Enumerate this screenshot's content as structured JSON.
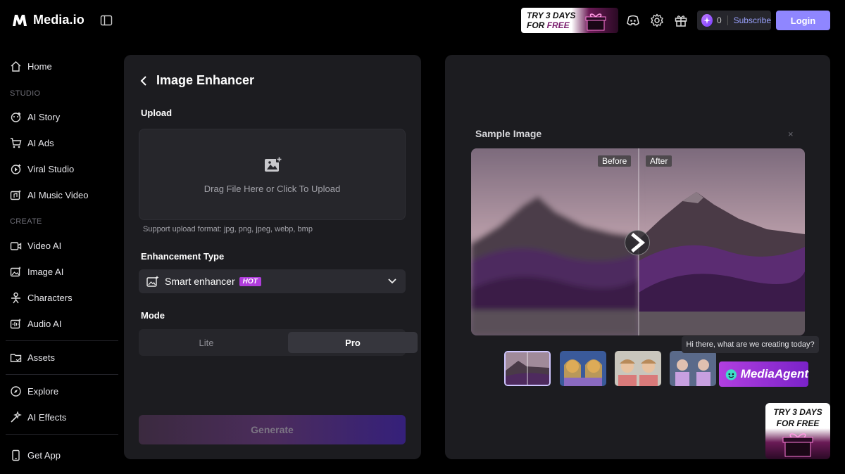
{
  "app": {
    "name": "Media.io"
  },
  "header": {
    "promo_line1": "TRY 3 DAYS",
    "promo_line2_prefix": "FOR ",
    "promo_line2_highlight": "FREE",
    "credits_count": "0",
    "subscribe_label": "Subscribe",
    "login_label": "Login"
  },
  "sidebar": {
    "home": "Home",
    "section_studio": "STUDIO",
    "ai_story": "AI Story",
    "ai_ads": "AI Ads",
    "viral_studio": "Viral Studio",
    "ai_music_video": "AI Music Video",
    "section_create": "CREATE",
    "video_ai": "Video AI",
    "image_ai": "Image AI",
    "characters": "Characters",
    "audio_ai": "Audio AI",
    "assets": "Assets",
    "explore": "Explore",
    "ai_effects": "AI Effects",
    "get_app": "Get App"
  },
  "tool": {
    "title": "Image Enhancer",
    "upload_label": "Upload",
    "upload_text": "Drag File Here or Click To Upload",
    "support_text": "Support upload format: jpg, png, jpeg, webp, bmp",
    "enhancement_label": "Enhancement Type",
    "enhancement_value": "Smart enhancer",
    "hot_badge": "HOT",
    "mode_label": "Mode",
    "mode_lite": "Lite",
    "mode_pro": "Pro",
    "mode_selected": "Pro",
    "generate_label": "Generate"
  },
  "sample": {
    "title": "Sample Image",
    "close_glyph": "×",
    "before_label": "Before",
    "after_label": "After",
    "tooltip": "Hi there, what are we creating today?",
    "agent_label": "MediaAgent"
  },
  "float_promo": {
    "line1": "TRY 3 DAYS",
    "line2": "FOR FREE"
  },
  "colors": {
    "accent": "#8f86ff",
    "hot": "#b03ddc",
    "panel": "#1c1c20"
  }
}
